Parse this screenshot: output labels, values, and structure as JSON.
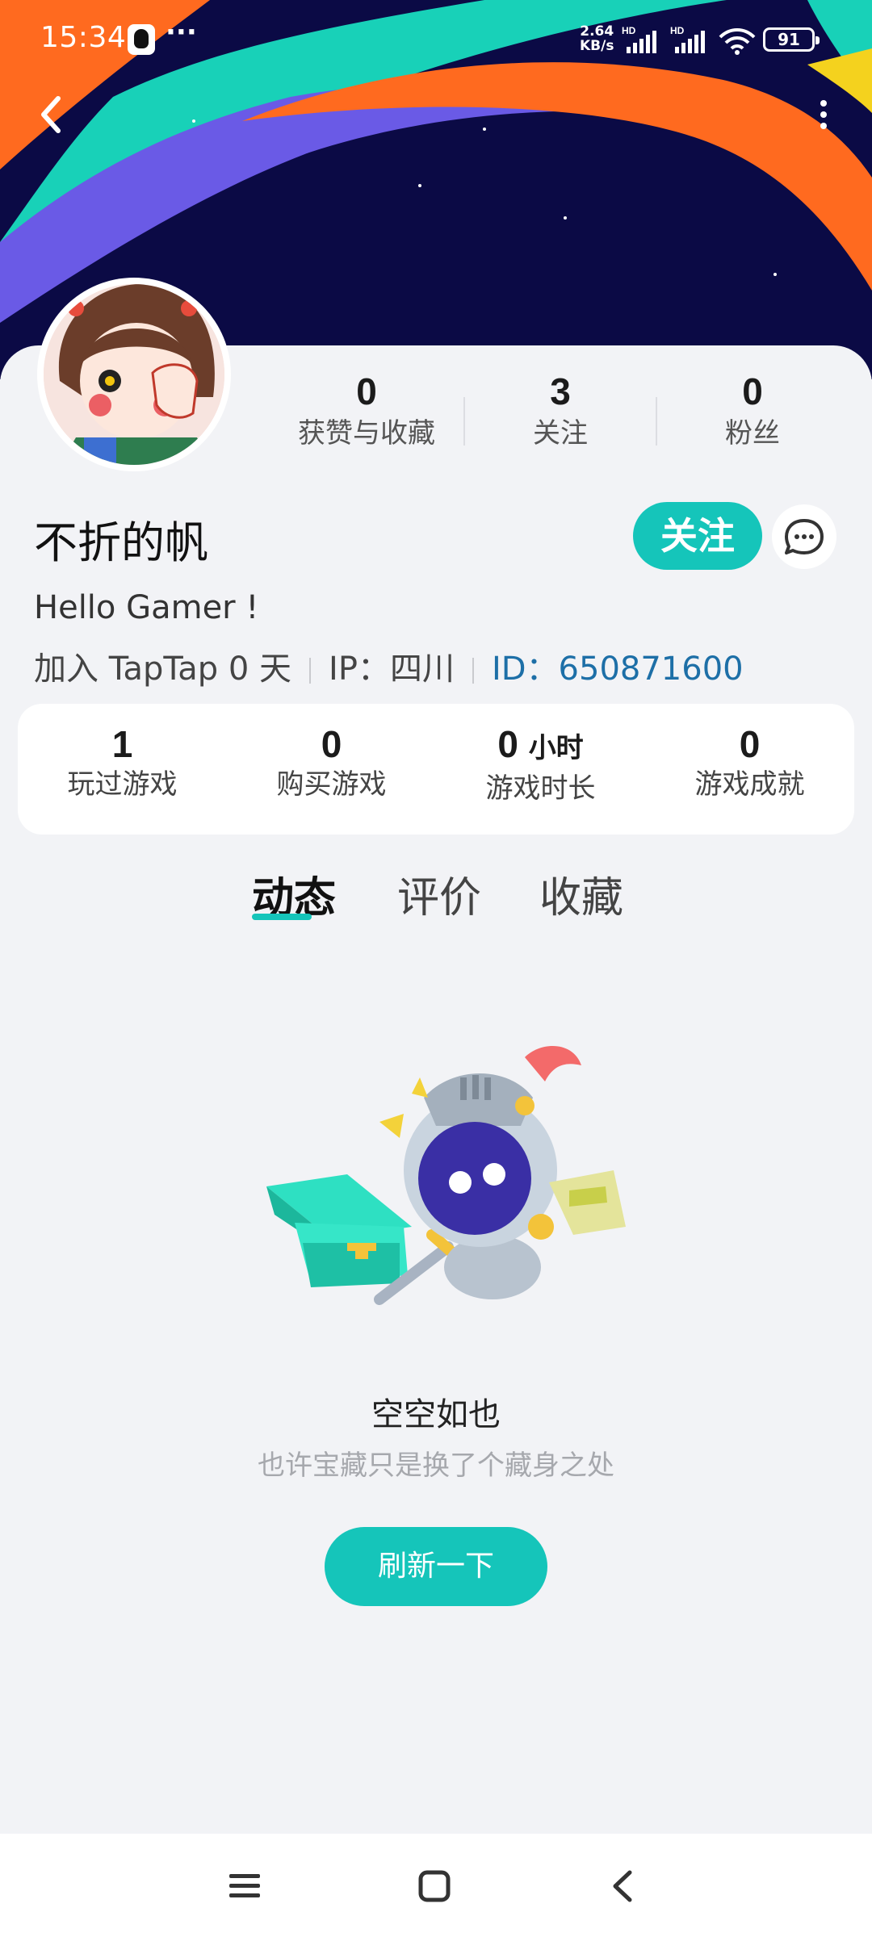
{
  "status_bar": {
    "time": "15:34",
    "more": "···",
    "net_speed_value": "2.64",
    "net_speed_unit": "KB/s",
    "hd1": "HD",
    "hd2": "HD",
    "battery": "91"
  },
  "profile": {
    "name": "不折的帆",
    "bio": "Hello Gamer !",
    "joined": "加入 TapTap 0 天",
    "ip": "IP：四川",
    "id": "ID：650871600",
    "follow_label": "关注"
  },
  "social_stats": [
    {
      "value": "0",
      "label": "获赞与收藏"
    },
    {
      "value": "3",
      "label": "关注"
    },
    {
      "value": "0",
      "label": "粉丝"
    }
  ],
  "game_stats": [
    {
      "value": "1",
      "unit": "",
      "label": "玩过游戏"
    },
    {
      "value": "0",
      "unit": "",
      "label": "购买游戏"
    },
    {
      "value": "0",
      "unit": "小时",
      "label": "游戏时长"
    },
    {
      "value": "0",
      "unit": "",
      "label": "游戏成就"
    }
  ],
  "tabs": [
    {
      "label": "动态",
      "active": true
    },
    {
      "label": "评价",
      "active": false
    },
    {
      "label": "收藏",
      "active": false
    }
  ],
  "empty_state": {
    "title": "空空如也",
    "subtitle": "也许宝藏只是换了个藏身之处",
    "button": "刷新一下"
  },
  "icons": {
    "back": "back-arrow-icon",
    "menu": "more-vertical-icon",
    "message": "chat-bubble-icon"
  },
  "colors": {
    "accent": "#15c5ba",
    "id_text": "#1d6fa7",
    "banner_bg": "#0b0a45"
  }
}
